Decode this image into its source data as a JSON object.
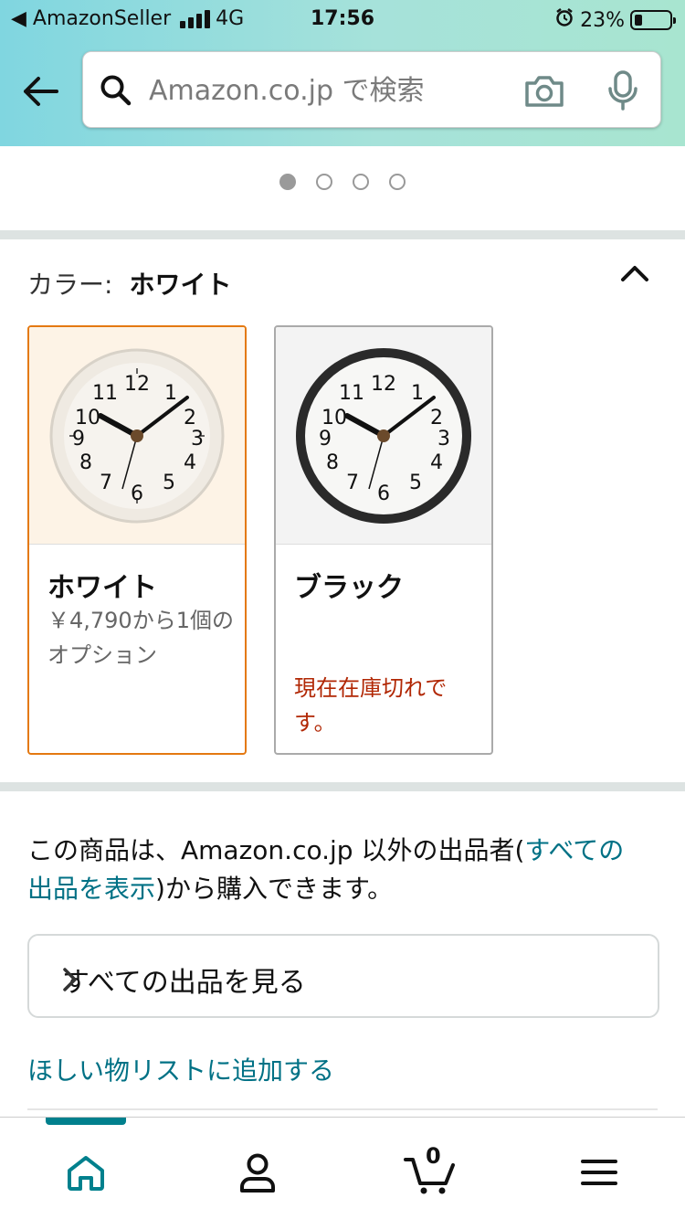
{
  "status_bar": {
    "carrier": "◀ AmazonSeller",
    "network": "4G",
    "time": "17:56",
    "battery": "23%"
  },
  "header": {
    "search_placeholder": "Amazon.co.jp で検索",
    "back_icon": "arrow-left-icon",
    "search_icon": "search-icon",
    "camera_icon": "camera-icon",
    "mic_icon": "microphone-icon"
  },
  "carousel": {
    "page_count": 4,
    "active_index": 0
  },
  "variations": {
    "label": "カラー:",
    "selected_value": "ホワイト",
    "options": [
      {
        "name": "ホワイト",
        "price_text": "￥4,790から1個のオプション",
        "status": ""
      },
      {
        "name": "ブラック",
        "price_text": "",
        "status": "現在在庫切れです。"
      }
    ]
  },
  "sellers": {
    "text_before": "この商品は、Amazon.co.jp 以外の出品者(",
    "link_text": "すべての出品を表示",
    "text_after": ")から購入できます。",
    "see_all_button": "すべての出品を見る",
    "wishlist_link": "ほしい物リストに追加する"
  },
  "tabbar": {
    "items": [
      "home-icon",
      "account-icon",
      "cart-icon",
      "menu-icon"
    ],
    "cart_count": "0"
  },
  "colors": {
    "accent_teal": "#007185",
    "selected_border": "#e47911",
    "out_of_stock": "#b12704"
  }
}
